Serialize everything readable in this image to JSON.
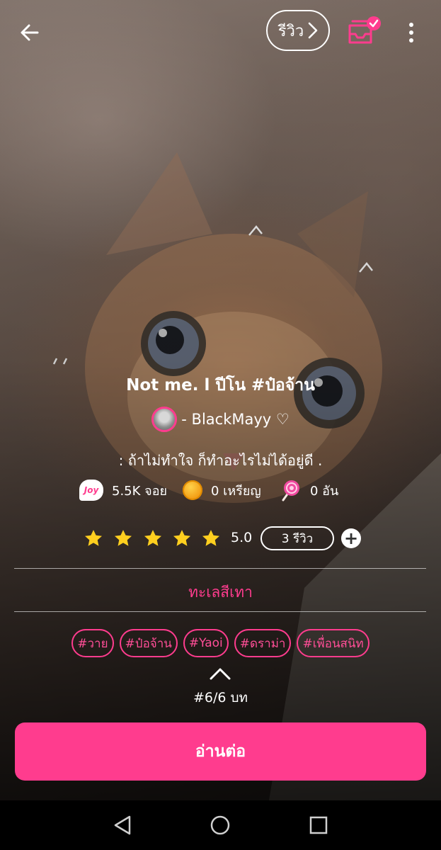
{
  "header": {
    "review_label": "รีวิว",
    "icons": [
      "back-arrow-icon",
      "chevron-right-icon",
      "inbox-check-icon",
      "more-vertical-icon"
    ]
  },
  "story": {
    "title": "Not me. l ปีโน #ป๋อจ้าน",
    "author": "- BlackMayy ♡",
    "tagline": ": ถ้าไม่ทำใจ ก็ทำอะไรไม่ได้อยู่ดี ."
  },
  "stats": {
    "joy_icon_text": "Joy",
    "joy": "5.5K จอย",
    "coins": "0 เหรียญ",
    "candies": "0 อัน"
  },
  "rating": {
    "stars": 5,
    "value": "5.0",
    "reviews": "3 รีวิว",
    "add_symbol": "+"
  },
  "category": "ทะเลสีเทา",
  "tags": [
    "#วาย",
    "#ป๋อจ้าน",
    "#Yaoi",
    "#ดราม่า",
    "#เพื่อนสนิท"
  ],
  "chapter": "#6/6 บท",
  "read_button": "อ่านต่อ",
  "colors": {
    "accent": "#ff3c8e",
    "star": "#ffcf1f"
  }
}
